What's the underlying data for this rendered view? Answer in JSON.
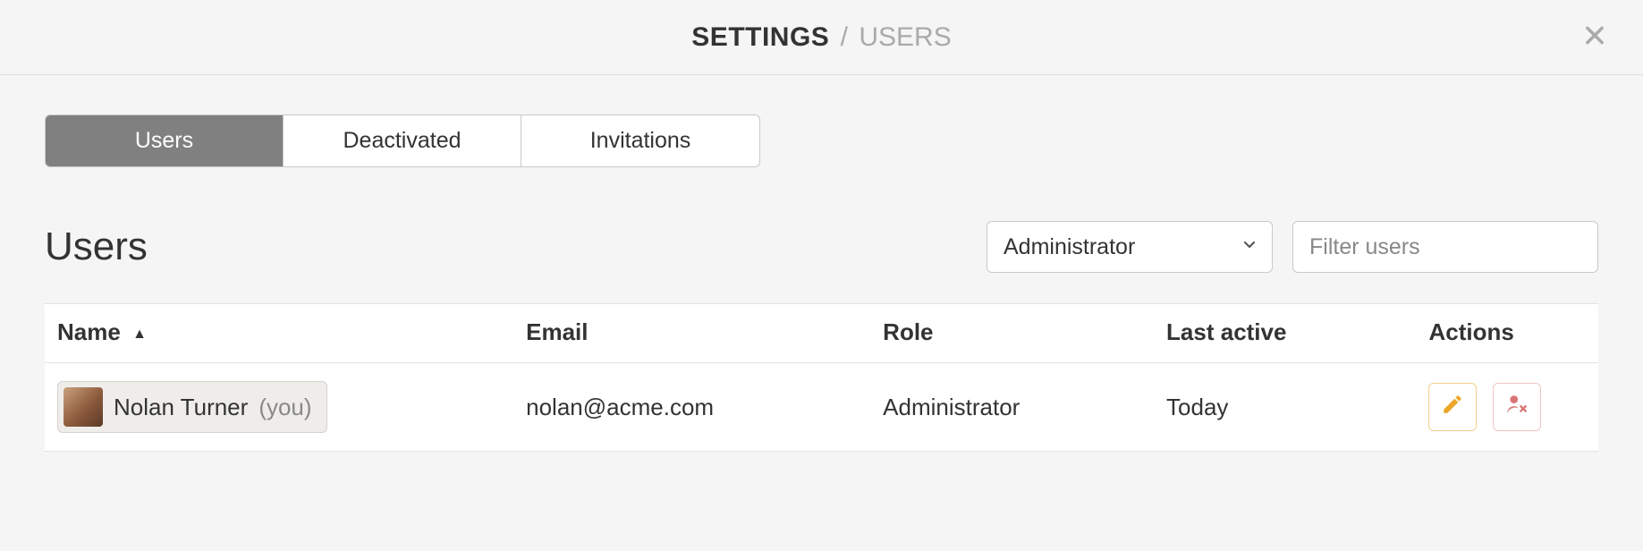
{
  "breadcrumb": {
    "main": "SETTINGS",
    "separator": "/",
    "sub": "USERS"
  },
  "tabs": [
    {
      "label": "Users",
      "active": true
    },
    {
      "label": "Deactivated",
      "active": false
    },
    {
      "label": "Invitations",
      "active": false
    }
  ],
  "section": {
    "title": "Users"
  },
  "roleFilter": {
    "selected": "Administrator"
  },
  "search": {
    "placeholder": "Filter users",
    "value": ""
  },
  "columns": {
    "name": "Name",
    "email": "Email",
    "role": "Role",
    "lastActive": "Last active",
    "actions": "Actions"
  },
  "sort": {
    "column": "name",
    "direction": "asc",
    "indicator": "▲"
  },
  "youTag": "(you)",
  "rows": [
    {
      "name": "Nolan Turner",
      "isYou": true,
      "email": "nolan@acme.com",
      "role": "Administrator",
      "lastActive": "Today"
    }
  ],
  "icons": {
    "close": "close-icon",
    "chevronDown": "chevron-down-icon",
    "edit": "pencil-icon",
    "removeUser": "user-x-icon"
  }
}
